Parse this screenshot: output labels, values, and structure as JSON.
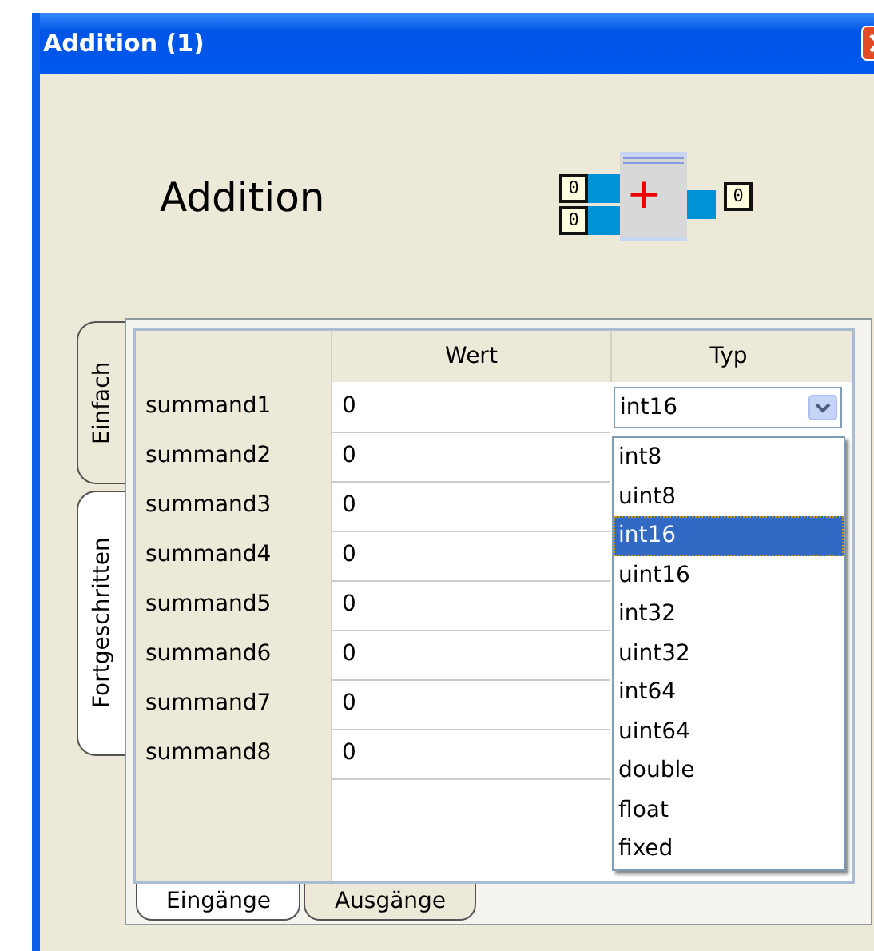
{
  "window": {
    "title": "Addition (1)"
  },
  "heading": "Addition",
  "block": {
    "inputs": [
      "0",
      "0"
    ],
    "output": "0",
    "symbol": "+"
  },
  "side_tabs": [
    {
      "label": "Einfach",
      "selected": false
    },
    {
      "label": "Fortgeschritten",
      "selected": true
    }
  ],
  "table": {
    "columns": [
      "Wert",
      "Typ"
    ],
    "rows": [
      {
        "name": "summand1",
        "value": "0",
        "type": "int16"
      },
      {
        "name": "summand2",
        "value": "0"
      },
      {
        "name": "summand3",
        "value": "0"
      },
      {
        "name": "summand4",
        "value": "0"
      },
      {
        "name": "summand5",
        "value": "0"
      },
      {
        "name": "summand6",
        "value": "0"
      },
      {
        "name": "summand7",
        "value": "0"
      },
      {
        "name": "summand8",
        "value": "0"
      }
    ]
  },
  "dropdown": {
    "options": [
      {
        "label": "int8",
        "selected": false
      },
      {
        "label": "uint8",
        "selected": false
      },
      {
        "label": "int16",
        "selected": true
      },
      {
        "label": "uint16",
        "selected": false
      },
      {
        "label": "int32",
        "selected": false
      },
      {
        "label": "uint32",
        "selected": false
      },
      {
        "label": "int64",
        "selected": false
      },
      {
        "label": "uint64",
        "selected": false
      },
      {
        "label": "double",
        "selected": false
      },
      {
        "label": "float",
        "selected": false
      },
      {
        "label": "fixed",
        "selected": false
      }
    ]
  },
  "bottom_tabs": [
    {
      "label": "Eingänge",
      "selected": true
    },
    {
      "label": "Ausgänge",
      "selected": false
    }
  ]
}
